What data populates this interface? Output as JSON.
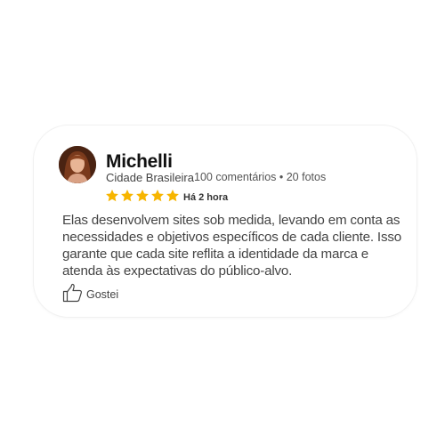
{
  "review": {
    "author_name": "Michelli",
    "location": "Cidade Brasileira",
    "stats": "100 comentários • 20 fotos",
    "rating": 5,
    "max_rating": 5,
    "star_color": "#f7b500",
    "time_ago": "Há 2 hora",
    "text": "Elas desenvolvem sites sob medida, levando em conta as necessidades e objetivos específicos de cada cliente. Isso garante que cada site reflita a identidade da marca e atenda às expectativas do público-alvo.",
    "like_label": "Gostei",
    "like_icon": "thumbs-up-icon",
    "avatar_icon": "user-avatar"
  }
}
